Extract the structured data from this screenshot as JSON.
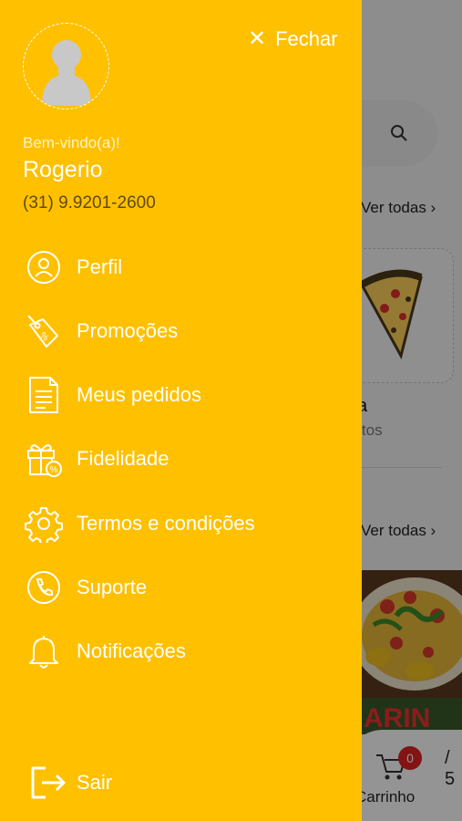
{
  "drawer": {
    "close_label": "Fechar",
    "welcome": "Bem-vindo(a)!",
    "user_name": "Rogerio",
    "user_phone": "(31) 9.9201-2600",
    "menu": [
      {
        "label": "Perfil",
        "icon": "user-circle-icon"
      },
      {
        "label": "Promoções",
        "icon": "price-tag-icon"
      },
      {
        "label": "Meus pedidos",
        "icon": "receipt-icon"
      },
      {
        "label": "Fidelidade",
        "icon": "gift-percent-icon"
      },
      {
        "label": "Termos e condições",
        "icon": "gear-icon"
      },
      {
        "label": "Suporte",
        "icon": "phone-icon"
      },
      {
        "label": "Notificações",
        "icon": "bell-icon"
      }
    ],
    "logout_label": "Sair",
    "colors": {
      "drawer_bg": "#ffc000",
      "text": "#ffffff"
    }
  },
  "background": {
    "see_all_1": "Ver todas ›",
    "see_all_2": "Ver todas ›",
    "category_name": "a",
    "category_sub": "dutos",
    "cart_label": "Carrinho",
    "cart_count": "0",
    "right_text": "/ 5"
  }
}
